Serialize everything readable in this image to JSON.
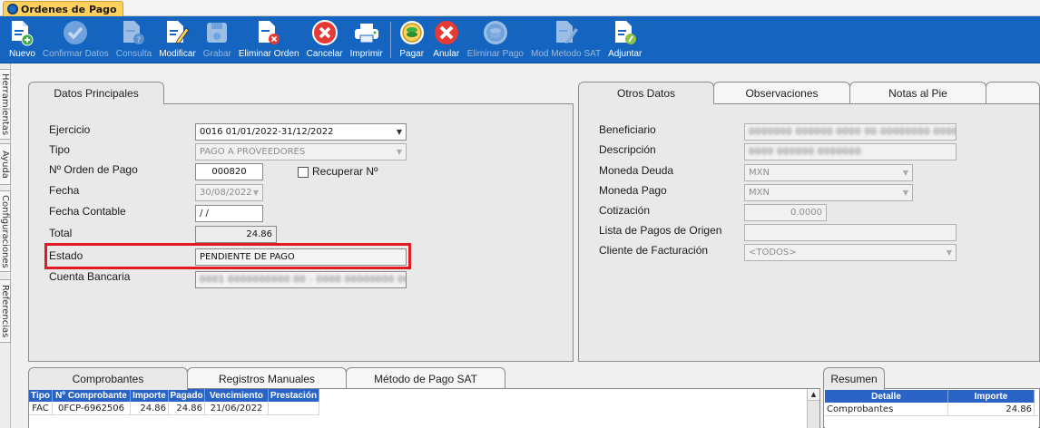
{
  "window": {
    "title": "Ordenes de Pago"
  },
  "toolbar": {
    "buttons": [
      {
        "label": "Nuevo",
        "enabled": true,
        "icon": "doc-plus-icon"
      },
      {
        "label": "Confirmar Datos",
        "enabled": false,
        "icon": "check-circle-icon"
      },
      {
        "label": "Consulta",
        "enabled": false,
        "icon": "doc-query-icon"
      },
      {
        "label": "Modificar",
        "enabled": true,
        "icon": "doc-edit-icon"
      },
      {
        "label": "Grabar",
        "enabled": false,
        "icon": "save-icon"
      },
      {
        "label": "Eliminar Orden",
        "enabled": true,
        "icon": "doc-delete-icon"
      },
      {
        "label": "Cancelar",
        "enabled": true,
        "icon": "cancel-circle-icon"
      },
      {
        "label": "Imprimir",
        "enabled": true,
        "icon": "printer-icon"
      },
      {
        "label": "Pagar",
        "enabled": true,
        "icon": "coins-icon"
      },
      {
        "label": "Anular",
        "enabled": true,
        "icon": "void-x-icon"
      },
      {
        "label": "Eliminar Pago",
        "enabled": false,
        "icon": "coins-delete-icon"
      },
      {
        "label": "Mod Metodo SAT",
        "enabled": false,
        "icon": "doc-edit-sat-icon"
      },
      {
        "label": "Adjuntar",
        "enabled": true,
        "icon": "doc-attach-icon"
      }
    ]
  },
  "side_tabs": [
    "Herramientas",
    "Ayuda",
    "Configuraciones",
    "Referencias"
  ],
  "left_panel": {
    "tab": "Datos Principales",
    "labels": {
      "ejercicio": "Ejercicio",
      "tipo": "Tipo",
      "orden": "Nº Orden de Pago",
      "fecha": "Fecha",
      "fecha_contable": "Fecha Contable",
      "total": "Total",
      "estado": "Estado",
      "cuenta": "Cuenta Bancaria",
      "recuperar": "Recuperar Nº"
    },
    "values": {
      "ejercicio": "0016 01/01/2022-31/12/2022",
      "tipo": "PAGO A PROVEEDORES",
      "orden": "000820",
      "fecha": "30/08/2022",
      "fecha_contable": " /  /",
      "total": "24.86",
      "estado": "PENDIENTE DE PAGO",
      "cuenta": "0001 0000000000 00 - 0000 00000000 0000"
    },
    "recuperar_checked": false
  },
  "right_panel": {
    "tabs": [
      "Otros Datos",
      "Observaciones",
      "Notas al Pie"
    ],
    "labels": {
      "beneficiario": "Beneficiario",
      "descripcion": "Descripción",
      "moneda_deuda": "Moneda Deuda",
      "moneda_pago": "Moneda Pago",
      "cotizacion": "Cotización",
      "lista_pagos": "Lista de Pagos de Origen",
      "cliente_fact": "Cliente de Facturación"
    },
    "values": {
      "beneficiario": "0000000 000000 0000 00 00000000 00000 00",
      "descripcion": "0000 000000 0000000",
      "moneda_deuda": "MXN",
      "moneda_pago": "MXN",
      "cotizacion": "0.0000",
      "lista_pagos": "",
      "cliente_fact": "<TODOS>"
    }
  },
  "bottom_tabs": [
    "Comprobantes",
    "Registros Manuales",
    "Método de Pago SAT"
  ],
  "comprobantes": {
    "columns": [
      "Tipo",
      "Nº Comprobante",
      "Importe",
      "Pagado",
      "Vencimiento",
      "Prestación"
    ],
    "rows": [
      [
        "FAC",
        "0FCP-6962506",
        "24.86",
        "24.86",
        "21/06/2022",
        ""
      ]
    ]
  },
  "resumen": {
    "tab": "Resumen",
    "columns": [
      "Detalle",
      "Importe"
    ],
    "rows": [
      [
        "Comprobantes",
        "24.86"
      ]
    ]
  },
  "colors": {
    "toolbar": "#1565c0",
    "grid_header": "#2a63c6",
    "highlight": "#e01b24",
    "title_tab": "#ffd15c"
  }
}
